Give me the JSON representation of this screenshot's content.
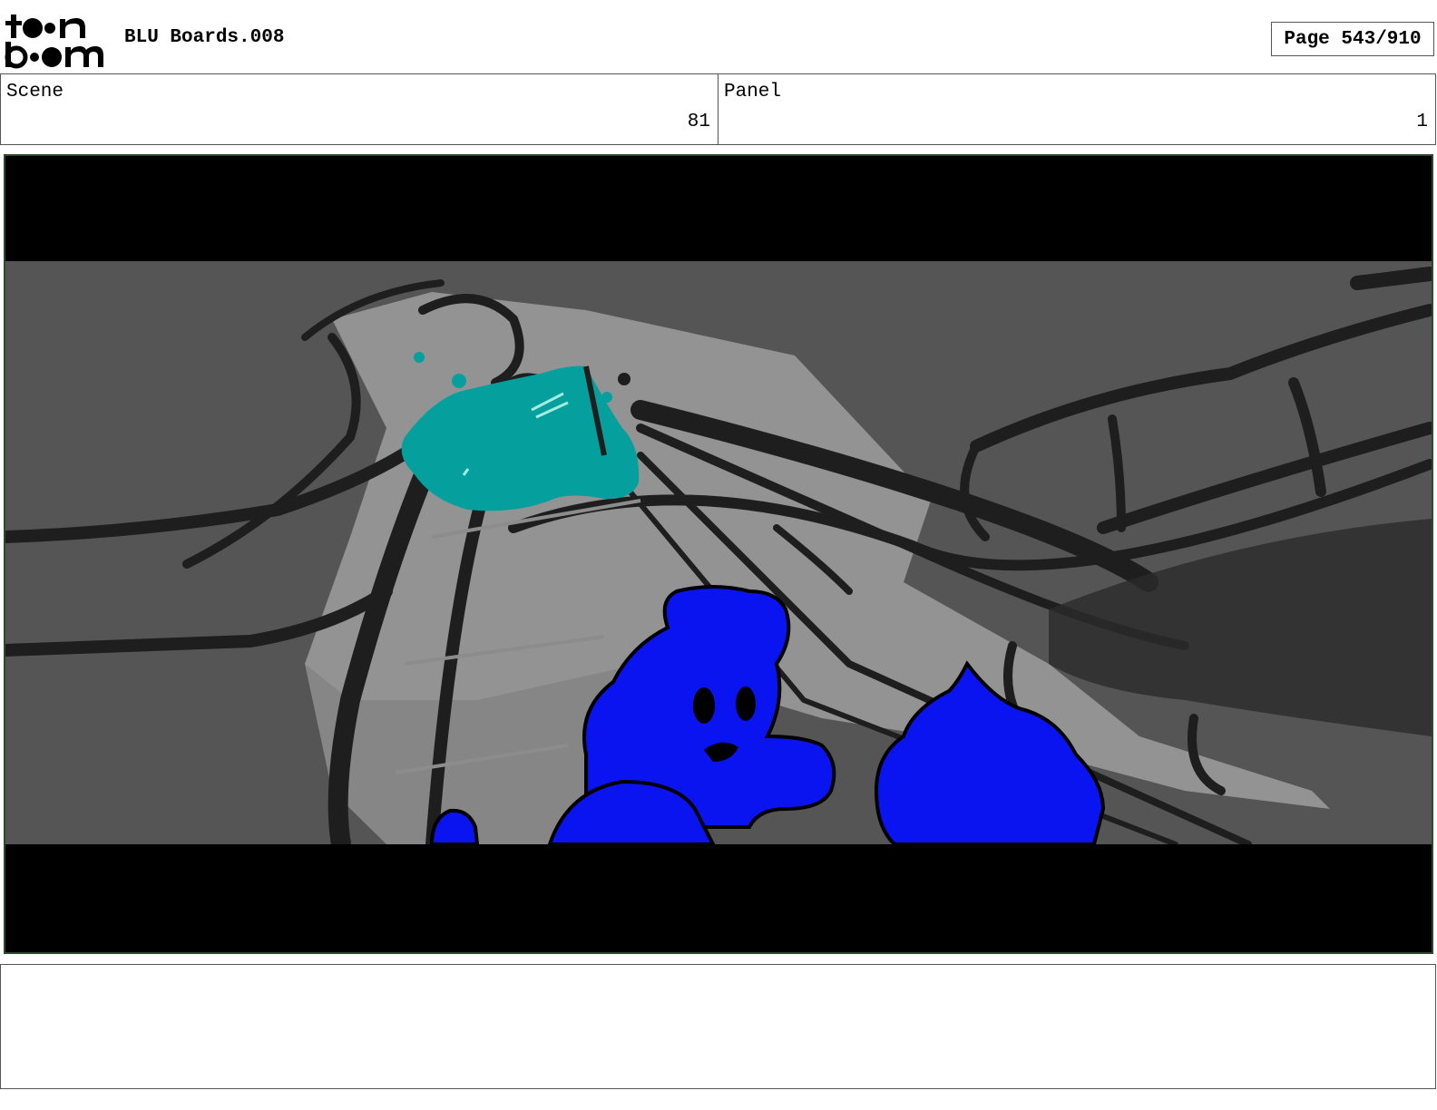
{
  "header": {
    "logo_alt": "toon boom",
    "title": "BLU Boards.008",
    "page": "Page 543/910"
  },
  "scene": {
    "label": "Scene",
    "value": "81"
  },
  "panel": {
    "label": "Panel",
    "value": "1"
  },
  "colors": {
    "letterbox": "#000000",
    "background_gray": "#555555",
    "light_gray": "#9a9a9a",
    "stroke": "#1e1e1e",
    "teal": "#05a09e",
    "blue": "#0a14f0",
    "border_green": "#2c4a2c"
  },
  "notes": ""
}
